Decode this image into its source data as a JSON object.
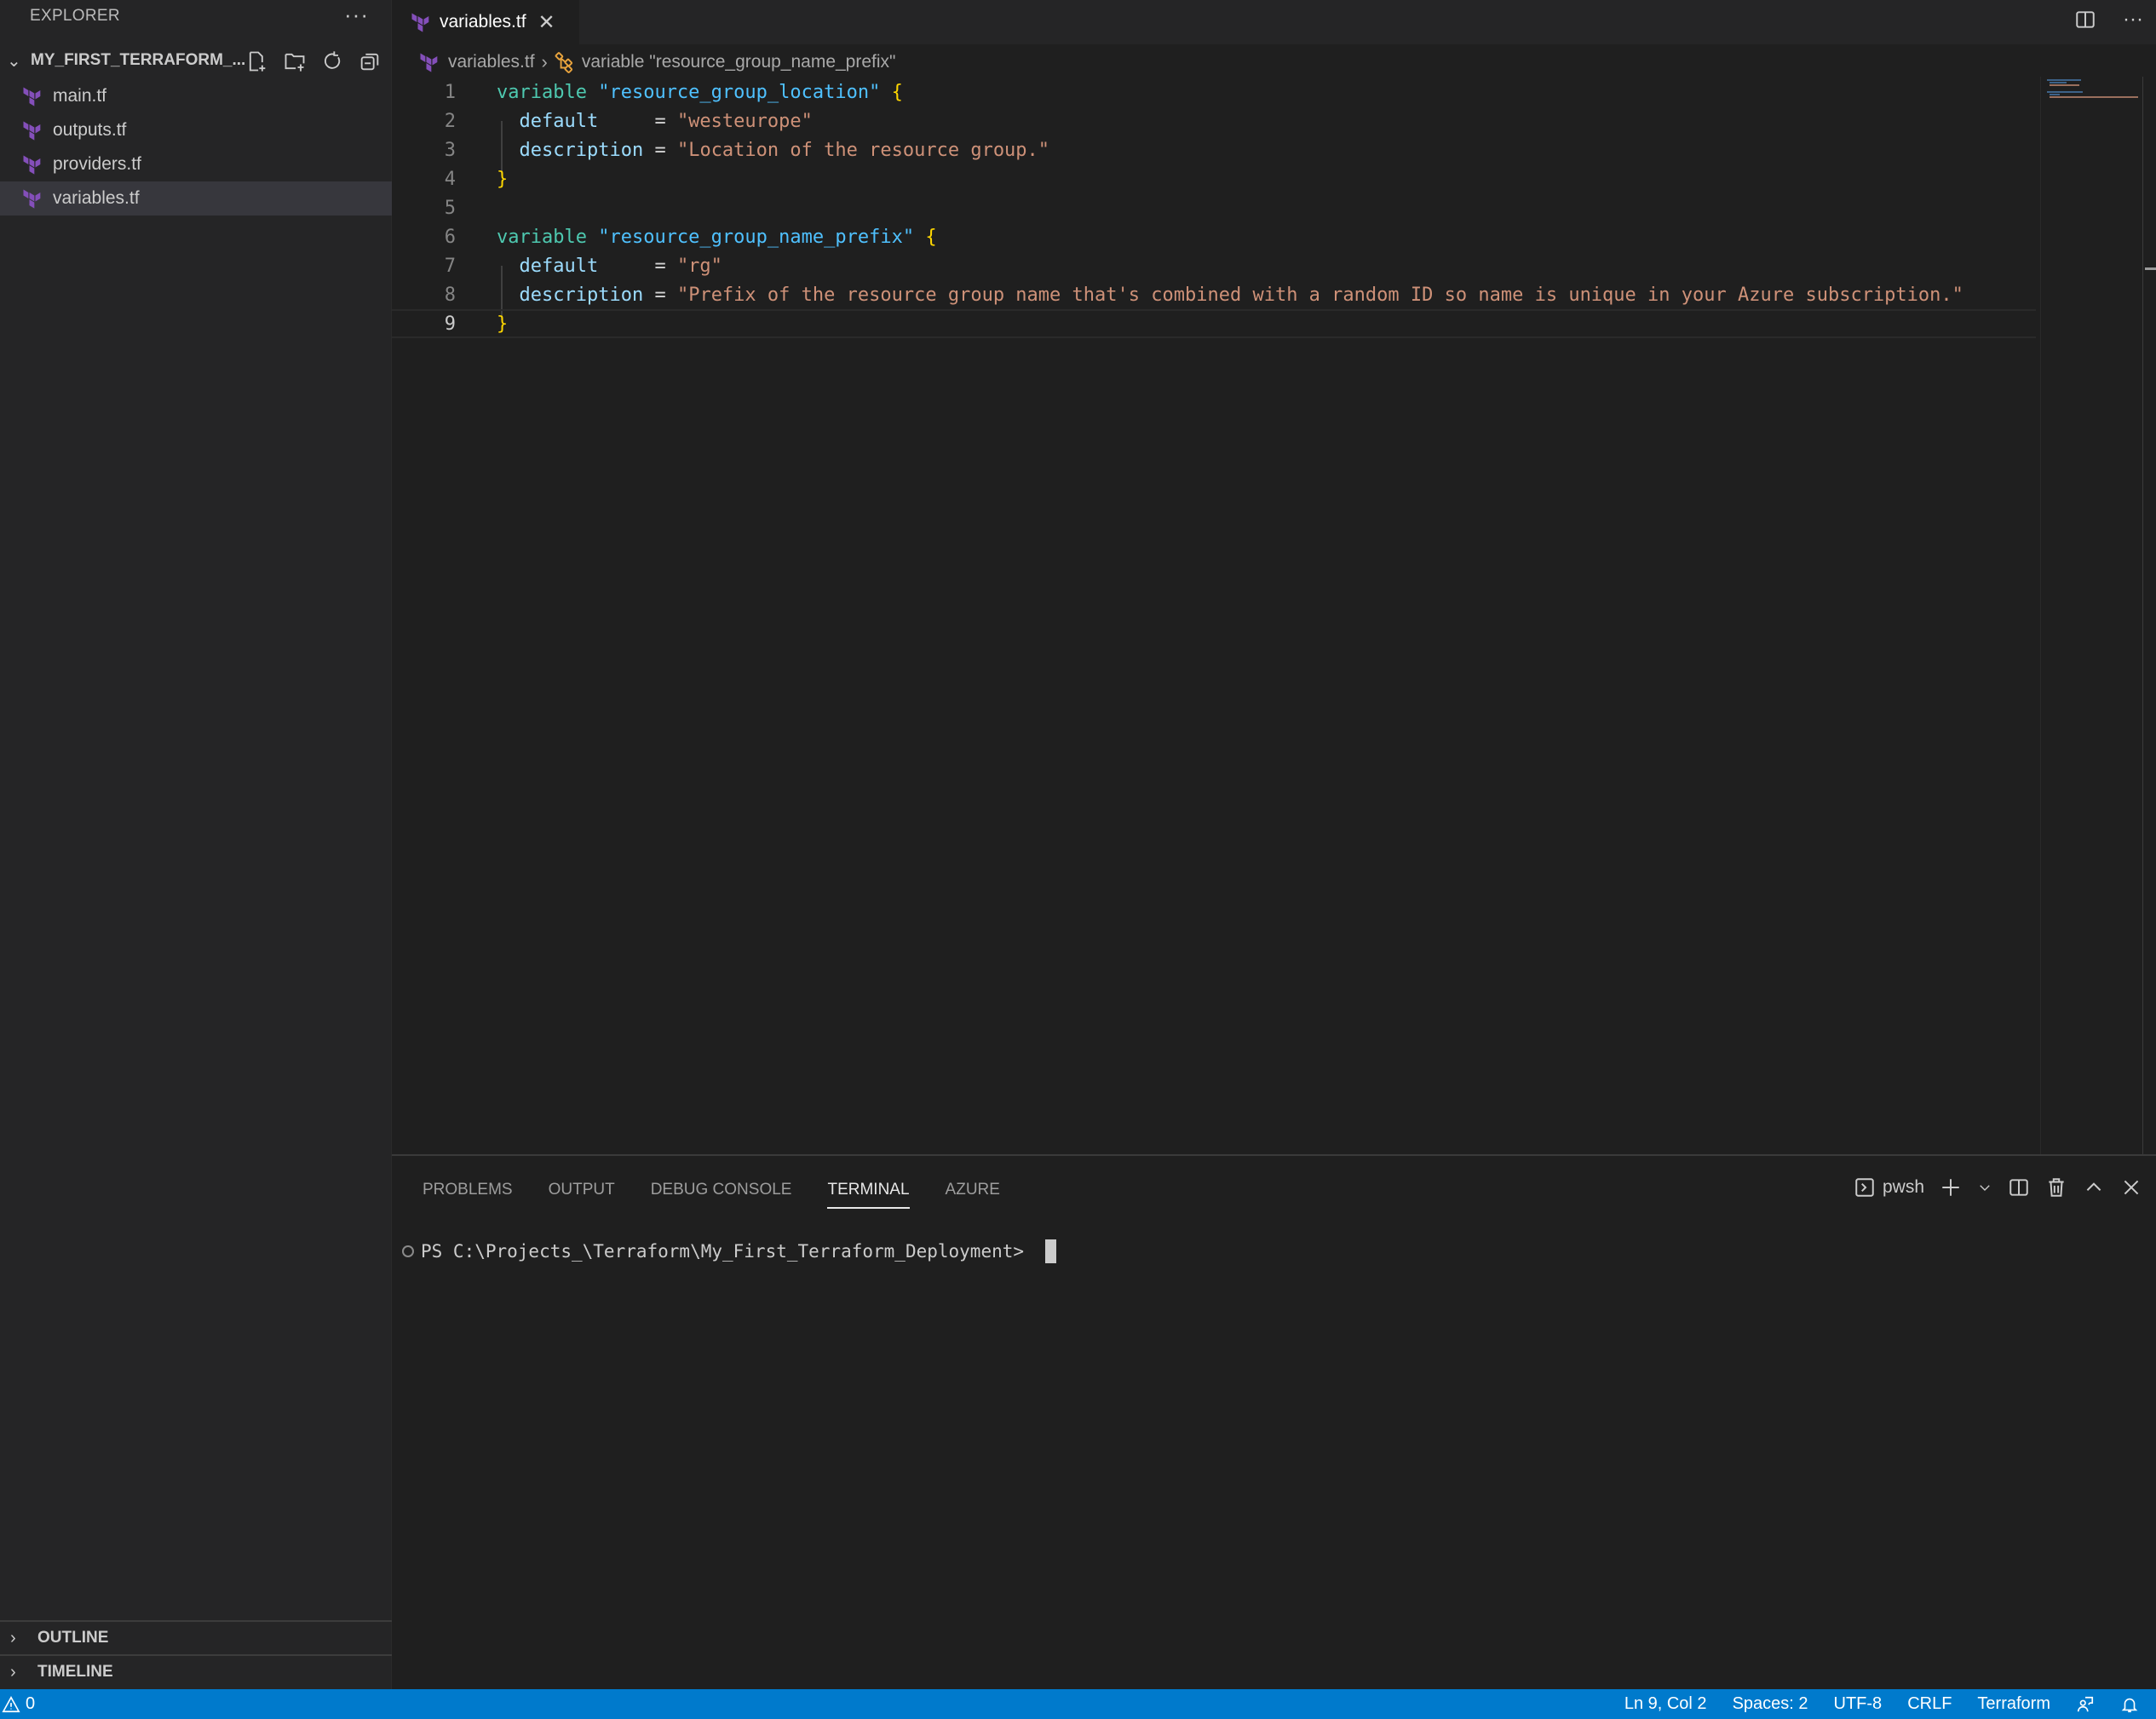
{
  "sidebar": {
    "title": "EXPLORER",
    "more_label": "···",
    "folder": {
      "name": "MY_FIRST_TERRAFORM_...",
      "actions": [
        "new-file",
        "new-folder",
        "refresh",
        "collapse-all"
      ]
    },
    "files": [
      {
        "name": "main.tf",
        "icon": "terraform-icon",
        "active": false
      },
      {
        "name": "outputs.tf",
        "icon": "terraform-icon",
        "active": false
      },
      {
        "name": "providers.tf",
        "icon": "terraform-icon",
        "active": false
      },
      {
        "name": "variables.tf",
        "icon": "terraform-icon",
        "active": true
      }
    ],
    "sections": [
      {
        "label": "OUTLINE"
      },
      {
        "label": "TIMELINE"
      }
    ]
  },
  "editor": {
    "tab": {
      "label": "variables.tf",
      "close": "✕"
    },
    "breadcrumb": {
      "file": "variables.tf",
      "separator": "›",
      "symbol": "variable \"resource_group_name_prefix\""
    },
    "lines": [
      {
        "n": "1",
        "tokens": [
          [
            "kw",
            "variable"
          ],
          [
            "op",
            " "
          ],
          [
            "str-name",
            "\"resource_group_location\""
          ],
          [
            "op",
            " "
          ],
          [
            "brace",
            "{"
          ]
        ]
      },
      {
        "n": "2",
        "tokens": [
          [
            "op",
            "  "
          ],
          [
            "attr",
            "default"
          ],
          [
            "op",
            "     = "
          ],
          [
            "str",
            "\"westeurope\""
          ]
        ]
      },
      {
        "n": "3",
        "tokens": [
          [
            "op",
            "  "
          ],
          [
            "attr",
            "description"
          ],
          [
            "op",
            " = "
          ],
          [
            "str",
            "\"Location of the resource group.\""
          ]
        ]
      },
      {
        "n": "4",
        "tokens": [
          [
            "brace",
            "}"
          ]
        ]
      },
      {
        "n": "5",
        "tokens": []
      },
      {
        "n": "6",
        "tokens": [
          [
            "kw",
            "variable"
          ],
          [
            "op",
            " "
          ],
          [
            "str-name",
            "\"resource_group_name_prefix\""
          ],
          [
            "op",
            " "
          ],
          [
            "brace",
            "{"
          ]
        ]
      },
      {
        "n": "7",
        "tokens": [
          [
            "op",
            "  "
          ],
          [
            "attr",
            "default"
          ],
          [
            "op",
            "     = "
          ],
          [
            "str",
            "\"rg\""
          ]
        ]
      },
      {
        "n": "8",
        "tokens": [
          [
            "op",
            "  "
          ],
          [
            "attr",
            "description"
          ],
          [
            "op",
            " = "
          ],
          [
            "str",
            "\"Prefix of the resource group name that's combined with a random ID so name is unique in your Azure subscription.\""
          ]
        ]
      },
      {
        "n": "9",
        "tokens": [
          [
            "brace",
            "}"
          ]
        ]
      }
    ],
    "current_line": 9
  },
  "panel": {
    "tabs": [
      {
        "label": "PROBLEMS",
        "active": false
      },
      {
        "label": "OUTPUT",
        "active": false
      },
      {
        "label": "DEBUG CONSOLE",
        "active": false
      },
      {
        "label": "TERMINAL",
        "active": true
      },
      {
        "label": "AZURE",
        "active": false
      }
    ],
    "terminal_name": "pwsh",
    "prompt": "PS C:\\Projects_\\Terraform\\My_First_Terraform_Deployment> "
  },
  "statusbar": {
    "problems_count": "0",
    "position": "Ln 9, Col 2",
    "spaces": "Spaces: 2",
    "encoding": "UTF-8",
    "eol": "CRLF",
    "language": "Terraform"
  },
  "colors": {
    "accent": "#007acc",
    "terraform_purple": "#844fba",
    "keyword": "#4ec9b0",
    "string": "#ce9178",
    "attribute": "#9cdcfe",
    "brace": "#ffd700"
  }
}
